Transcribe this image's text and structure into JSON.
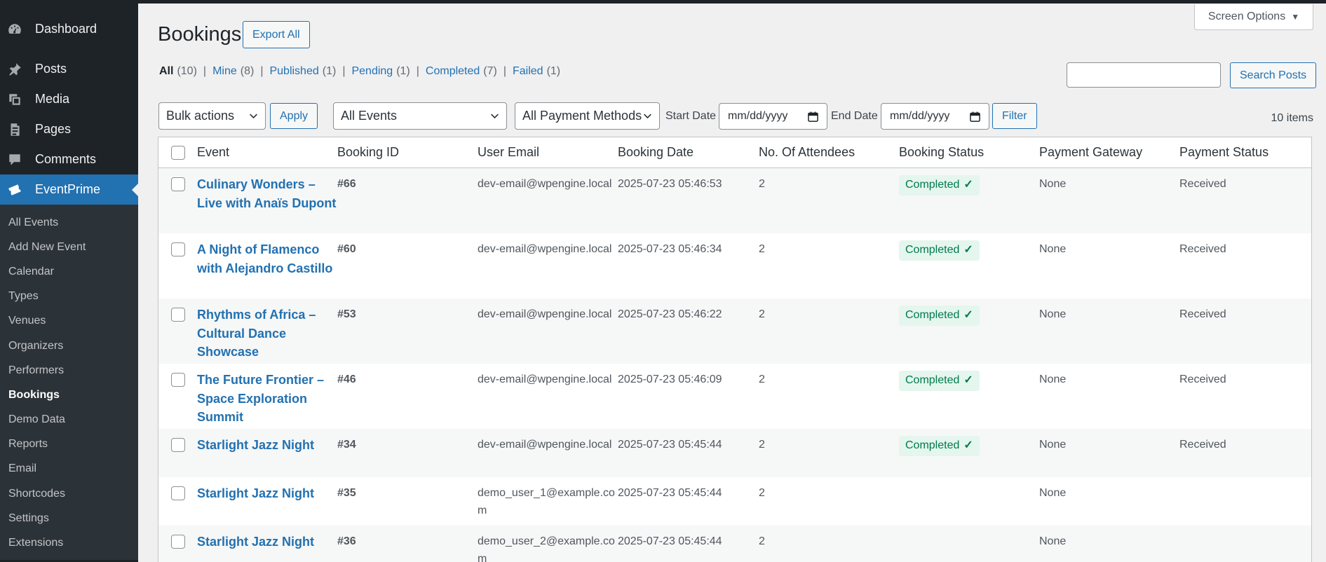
{
  "sidebar": {
    "menu": [
      {
        "label": "Dashboard",
        "icon": "dashboard-icon"
      },
      {
        "label": "Posts",
        "icon": "pin-icon"
      },
      {
        "label": "Media",
        "icon": "media-icon"
      },
      {
        "label": "Pages",
        "icon": "pages-icon"
      },
      {
        "label": "Comments",
        "icon": "comments-icon"
      },
      {
        "label": "EventPrime",
        "icon": "tickets-icon"
      }
    ],
    "submenu": [
      "All Events",
      "Add New Event",
      "Calendar",
      "Types",
      "Venues",
      "Organizers",
      "Performers",
      "Bookings",
      "Demo Data",
      "Reports",
      "Email",
      "Shortcodes",
      "Settings",
      "Extensions"
    ]
  },
  "header": {
    "screen_options": "Screen Options",
    "title": "Bookings",
    "export_all": "Export All"
  },
  "filters": {
    "views": [
      {
        "label": "All",
        "count": "(10)"
      },
      {
        "label": "Mine",
        "count": "(8)"
      },
      {
        "label": "Published",
        "count": "(1)"
      },
      {
        "label": "Pending",
        "count": "(1)"
      },
      {
        "label": "Completed",
        "count": "(7)"
      },
      {
        "label": "Failed",
        "count": "(1)"
      }
    ],
    "search_value": "",
    "search_button": "Search Posts",
    "bulk_actions": "Bulk actions",
    "apply": "Apply",
    "events_select": "All Events",
    "payment_select": "All Payment Methods",
    "start_date_label": "Start Date",
    "start_date_placeholder": "mm/dd/yyyy",
    "end_date_label": "End Date",
    "end_date_placeholder": "mm/dd/yyyy",
    "filter_button": "Filter",
    "items_count": "10 items"
  },
  "table": {
    "columns": [
      "Event",
      "Booking ID",
      "User Email",
      "Booking Date",
      "No. Of Attendees",
      "Booking Status",
      "Payment Gateway",
      "Payment Status"
    ],
    "rows": [
      {
        "event": "Culinary Wonders – Live with Anaïs Dupont",
        "id": "#66",
        "email": "dev-email@wpengine.local",
        "date": "2025-07-23 05:46:53",
        "attendees": "2",
        "status": "Completed",
        "gateway": "None",
        "payment": "Received"
      },
      {
        "event": "A Night of Flamenco with Alejandro Castillo",
        "id": "#60",
        "email": "dev-email@wpengine.local",
        "date": "2025-07-23 05:46:34",
        "attendees": "2",
        "status": "Completed",
        "gateway": "None",
        "payment": "Received"
      },
      {
        "event": "Rhythms of Africa – Cultural Dance Showcase",
        "id": "#53",
        "email": "dev-email@wpengine.local",
        "date": "2025-07-23 05:46:22",
        "attendees": "2",
        "status": "Completed",
        "gateway": "None",
        "payment": "Received"
      },
      {
        "event": "The Future Frontier – Space Exploration Summit",
        "id": "#46",
        "email": "dev-email@wpengine.local",
        "date": "2025-07-23 05:46:09",
        "attendees": "2",
        "status": "Completed",
        "gateway": "None",
        "payment": "Received"
      },
      {
        "event": "Starlight Jazz Night",
        "id": "#34",
        "email": "dev-email@wpengine.local",
        "date": "2025-07-23 05:45:44",
        "attendees": "2",
        "status": "Completed",
        "gateway": "None",
        "payment": "Received"
      },
      {
        "event": "Starlight Jazz Night",
        "id": "#35",
        "email": "demo_user_1@example.com",
        "date": "2025-07-23 05:45:44",
        "attendees": "2",
        "status": "",
        "gateway": "None",
        "payment": ""
      },
      {
        "event": "Starlight Jazz Night",
        "id": "#36",
        "email": "demo_user_2@example.com",
        "date": "2025-07-23 05:45:44",
        "attendees": "2",
        "status": "",
        "gateway": "None",
        "payment": ""
      }
    ]
  },
  "colors": {
    "accent": "#2271b1",
    "sidebar_bg": "#1d2327",
    "success": "#007a4d"
  }
}
